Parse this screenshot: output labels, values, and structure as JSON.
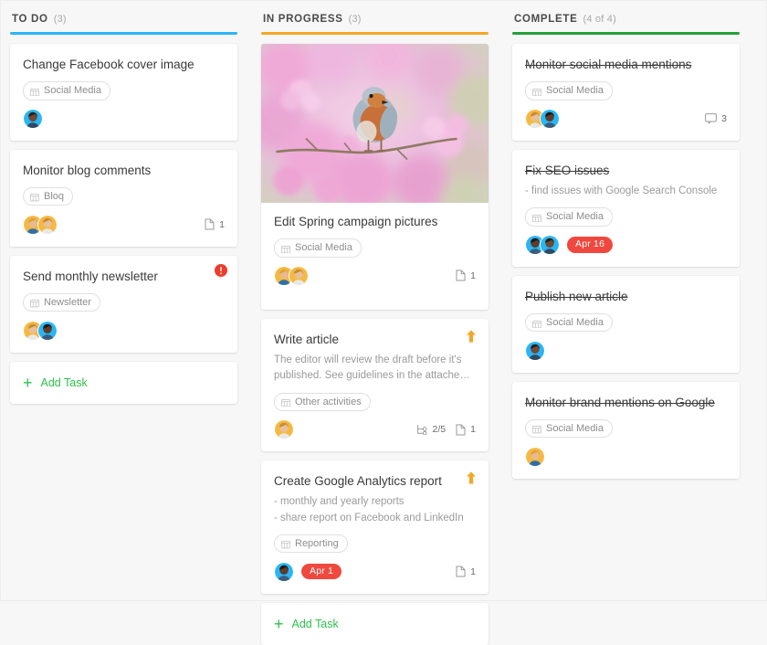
{
  "board": {
    "accent_todo": "#29b6f6",
    "accent_progress": "#f5a623",
    "accent_complete": "#21a038",
    "accent_add": "#2ec04b",
    "accent_due": "#f0483e",
    "add_task_label": "Add Task",
    "add_plus_glyph": "+"
  },
  "columns": [
    {
      "id": "todo",
      "title": "TO DO",
      "count": "(3)",
      "rule_class": "rule-todo",
      "cards": [
        {
          "title": "Change Facebook cover image",
          "done": false,
          "tag": "Social Media",
          "tag_icon": "table-icon",
          "avatars": [
            "brunette-blue",
            null
          ],
          "avatar_count": 1,
          "alert": false,
          "priority": false
        },
        {
          "title": "Monitor blog comments",
          "done": false,
          "tag": "Bloq",
          "tag_icon": "table-icon",
          "avatar_count": 2,
          "attachments": "1",
          "alert": false,
          "priority": false
        },
        {
          "title": "Send monthly newsletter",
          "done": false,
          "tag": "Newsletter",
          "tag_icon": "table-icon",
          "avatar_count": 2,
          "alert": true,
          "priority": false
        }
      ]
    },
    {
      "id": "progress",
      "title": "IN PROGRESS",
      "count": "(3)",
      "rule_class": "rule-progress",
      "cards": [
        {
          "title": "Edit Spring campaign pictures",
          "cover": "spring-bird-blossom",
          "done": false,
          "tag": "Social Media",
          "tag_icon": "table-icon",
          "avatar_count": 2,
          "attachments": "1",
          "alert": false,
          "priority": false
        },
        {
          "title": "Write article",
          "done": false,
          "desc": [
            "The editor will review the draft before it's",
            "published. See guidelines in the attached file."
          ],
          "tag": "Other activities",
          "tag_icon": "table-icon",
          "avatar_count": 1,
          "subtasks": "2/5",
          "attachments": "1",
          "alert": false,
          "priority": true
        },
        {
          "title": "Create Google Analytics report",
          "done": false,
          "desc": [
            "- monthly and yearly reports",
            "- share report on Facebook and LinkedIn"
          ],
          "tag": "Reporting",
          "tag_icon": "table-icon",
          "avatar_count": 1,
          "due": "Apr 1",
          "attachments": "1",
          "alert": false,
          "priority": true
        }
      ]
    },
    {
      "id": "complete",
      "title": "COMPLETE",
      "count": "(4 of 4)",
      "rule_class": "rule-complete",
      "cards": [
        {
          "title": "Monitor social media mentions",
          "done": true,
          "tag": "Social Media",
          "tag_icon": "table-icon",
          "avatar_count": 2,
          "comments": "3",
          "alert": false,
          "priority": false
        },
        {
          "title": "Fix SEO issues",
          "done": true,
          "desc": [
            "- find issues with Google Search Console"
          ],
          "tag": "Social Media",
          "tag_icon": "table-icon",
          "avatar_count": 2,
          "due": "Apr 16",
          "alert": false,
          "priority": false
        },
        {
          "title": "Publish new article",
          "done": true,
          "tag": "Social Media",
          "tag_icon": "table-icon",
          "avatar_count": 1,
          "alert": false,
          "priority": false
        },
        {
          "title": "Monitor brand mentions on Google",
          "done": true,
          "tag": "Social Media",
          "tag_icon": "table-icon",
          "avatar_count": 1,
          "alert": false,
          "priority": false
        }
      ]
    }
  ]
}
